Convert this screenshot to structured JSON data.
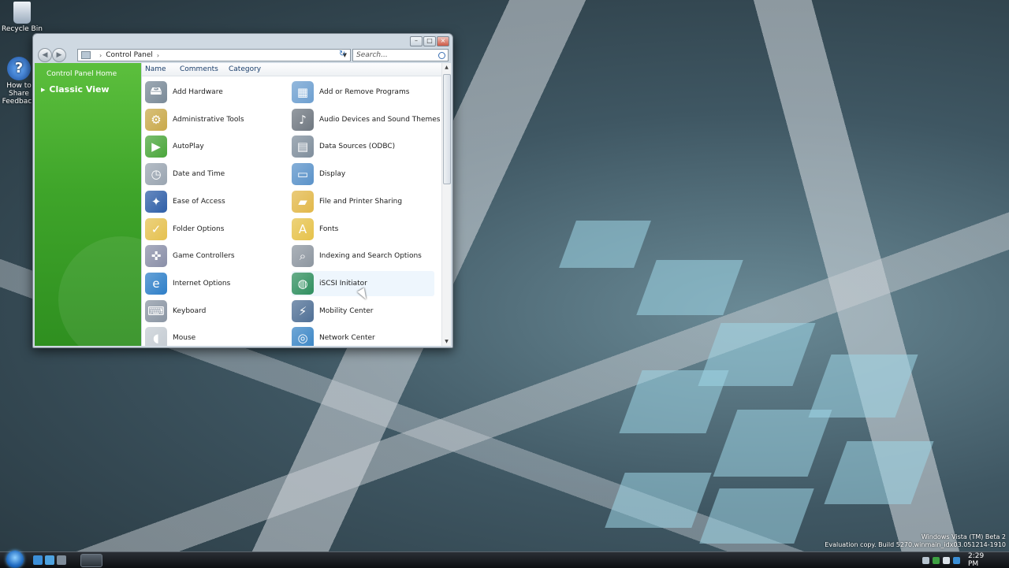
{
  "desktop": {
    "icons": [
      {
        "label": "Recycle Bin",
        "icon": "recycle-bin-icon",
        "color": "#c9d6e2"
      },
      {
        "label": "How to Share Feedback",
        "icon": "help-icon",
        "color": "#2b6fc4"
      }
    ],
    "watermark": {
      "line1": "Windows Vista (TM) Beta 2",
      "line2": "Evaluation copy. Build 5270.winmain_idx03.051214-1910"
    }
  },
  "window": {
    "title_buttons": {
      "minimize": "–",
      "maximize": "□",
      "close": "×"
    },
    "nav": {
      "back": "◀",
      "forward": "▶"
    },
    "address": {
      "crumb": "Control Panel"
    },
    "search": {
      "placeholder": "Search..."
    },
    "sidebar": {
      "home_link": "Control Panel Home",
      "classic_view": "Classic View"
    },
    "columns": [
      "Name",
      "Comments",
      "Category"
    ],
    "items": [
      {
        "label": "Add Hardware",
        "icon": "add-hardware-icon",
        "color": "#7a8a98",
        "glyph": "🖴"
      },
      {
        "label": "Add or Remove Programs",
        "icon": "add-remove-programs-icon",
        "color": "#6d9fd0",
        "glyph": "▦"
      },
      {
        "label": "Administrative Tools",
        "icon": "administrative-tools-icon",
        "color": "#c9a94a",
        "glyph": "⚙"
      },
      {
        "label": "Audio Devices and Sound Themes",
        "icon": "speaker-icon",
        "color": "#6f7780",
        "glyph": "♪"
      },
      {
        "label": "AutoPlay",
        "icon": "autoplay-icon",
        "color": "#4aa63a",
        "glyph": "▶"
      },
      {
        "label": "Data Sources (ODBC)",
        "icon": "data-sources-icon",
        "color": "#7f8e9c",
        "glyph": "▤"
      },
      {
        "label": "Date and Time",
        "icon": "clock-icon",
        "color": "#9aa5b1",
        "glyph": "◷"
      },
      {
        "label": "Display",
        "icon": "display-icon",
        "color": "#5a92c9",
        "glyph": "▭"
      },
      {
        "label": "Ease of Access",
        "icon": "ease-of-access-icon",
        "color": "#2f5fa8",
        "glyph": "✦"
      },
      {
        "label": "File and Printer Sharing",
        "icon": "folder-share-icon",
        "color": "#e2b84a",
        "glyph": "▰"
      },
      {
        "label": "Folder Options",
        "icon": "folder-options-icon",
        "color": "#e5c14f",
        "glyph": "✓"
      },
      {
        "label": "Fonts",
        "icon": "fonts-folder-icon",
        "color": "#e6c24a",
        "glyph": "A"
      },
      {
        "label": "Game Controllers",
        "icon": "gamepad-icon",
        "color": "#8a8fa8",
        "glyph": "✜"
      },
      {
        "label": "Indexing and Search Options",
        "icon": "indexing-icon",
        "color": "#8d96a0",
        "glyph": "⌕"
      },
      {
        "label": "Internet Options",
        "icon": "internet-options-icon",
        "color": "#2e7fc8",
        "glyph": "e"
      },
      {
        "label": "iSCSI Initiator",
        "icon": "globe-icon",
        "color": "#2f8f5f",
        "glyph": "◍"
      },
      {
        "label": "Keyboard",
        "icon": "keyboard-icon",
        "color": "#8a95a3",
        "glyph": "⌨"
      },
      {
        "label": "Mobility Center",
        "icon": "mobility-center-icon",
        "color": "#4f6f95",
        "glyph": "⚡"
      },
      {
        "label": "Mouse",
        "icon": "mouse-icon",
        "color": "#c5ccd3",
        "glyph": "◖"
      },
      {
        "label": "Network Center",
        "icon": "network-center-icon",
        "color": "#3b86c6",
        "glyph": "◎"
      }
    ],
    "hovered_item": "iSCSI Initiator"
  },
  "taskbar": {
    "start_icon": "windows-start-icon",
    "quicklaunch": [
      {
        "icon": "internet-explorer-icon",
        "color": "#3c8fd8"
      },
      {
        "icon": "windows-explorer-icon",
        "color": "#4ea3e0"
      },
      {
        "icon": "show-desktop-icon",
        "color": "#7e8c99"
      }
    ],
    "tray_icons": [
      {
        "icon": "network-tray-icon",
        "color": "#b7c4cf"
      },
      {
        "icon": "security-tray-icon",
        "color": "#3da042"
      },
      {
        "icon": "volume-tray-icon",
        "color": "#dbe3ea"
      },
      {
        "icon": "update-tray-icon",
        "color": "#3a8fd6"
      }
    ],
    "clock": "2:29 PM"
  }
}
